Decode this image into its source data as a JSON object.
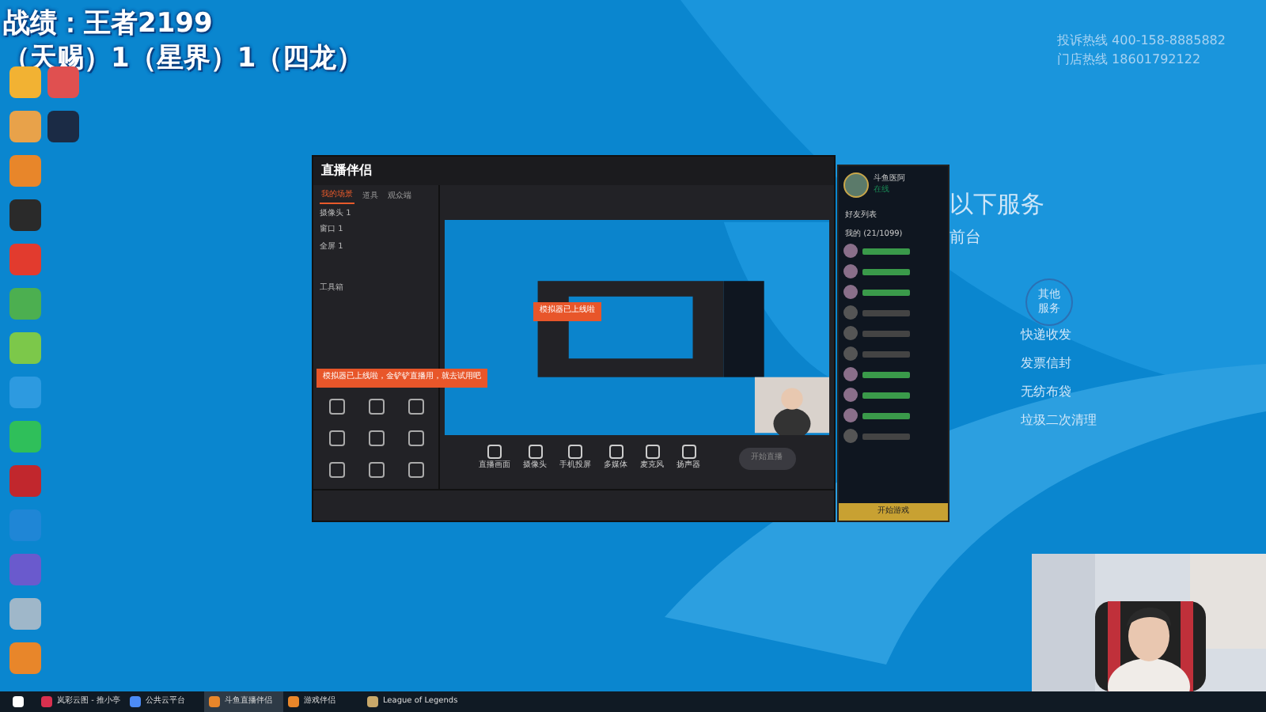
{
  "overlay": {
    "lines": [
      "战绩：王者2199",
      "（天赐）1（星界）1（四龙）"
    ]
  },
  "desktop_icons": [
    {
      "color": "#f2b233"
    },
    {
      "color": "#e05050"
    },
    {
      "color": "#e8a24a"
    },
    {
      "color": "#1b2b45"
    },
    {
      "color": "#e8862a"
    },
    {
      "color": "#2a2a2a"
    },
    {
      "color": "#e23b2e"
    },
    {
      "color": "#4caf50"
    },
    {
      "color": "#7cc84a"
    },
    {
      "color": "#2d9ae0"
    },
    {
      "color": "#2fbf5a"
    },
    {
      "color": "#c1272d"
    },
    {
      "color": "#1f86d6"
    },
    {
      "color": "#6a5acd"
    },
    {
      "color": "#9fb7c9"
    },
    {
      "color": "#e8862a"
    }
  ],
  "wallpaper": {
    "hotlines": [
      "投诉热线  400-158-8885882",
      "门店热线  18601792122"
    ],
    "heading": "以下服务",
    "subheading": "前台",
    "circle": "其他服务",
    "services": [
      "快递收发",
      "发票信封",
      "无纺布袋",
      "垃圾二次清理"
    ]
  },
  "app": {
    "title": "直播伴侣",
    "tabs": [
      {
        "label": "我的场景",
        "selected": true
      },
      {
        "label": "道具",
        "selected": false
      },
      {
        "label": "观众端",
        "selected": false
      }
    ],
    "sources": [
      "摄像头 1",
      "窗口 1",
      "全屏 1"
    ],
    "toolbox": "工具箱",
    "banner": "模拟器已上线啦，金铲铲直播用，就去试用吧",
    "preview_banner": "模拟器已上线啦",
    "toolbar": [
      "直播画面",
      "摄像头",
      "手机投屏",
      "多媒体",
      "麦克风",
      "扬声器"
    ],
    "start_button": "开始直播"
  },
  "friends": {
    "name": "斗鱼医阿",
    "status": "在线",
    "header": "好友列表",
    "group": "我的 (21/1099)",
    "items": [
      {
        "online": true
      },
      {
        "online": true
      },
      {
        "online": true
      },
      {
        "online": false
      },
      {
        "online": false
      },
      {
        "online": false
      },
      {
        "online": true
      },
      {
        "online": true
      },
      {
        "online": true
      },
      {
        "online": false
      }
    ],
    "footer": "开始游戏"
  },
  "taskbar": [
    {
      "label": "岚彩云图 - 推小亭",
      "color": "#d9304f",
      "selected": false
    },
    {
      "label": "公共云平台",
      "color": "#4c8bf5",
      "selected": false
    },
    {
      "label": "斗鱼直播伴侣",
      "color": "#e8862a",
      "selected": true
    },
    {
      "label": "游戏伴侣",
      "color": "#e8862a",
      "selected": false
    },
    {
      "label": "League of Legends",
      "color": "#c8a86a",
      "selected": false
    }
  ]
}
